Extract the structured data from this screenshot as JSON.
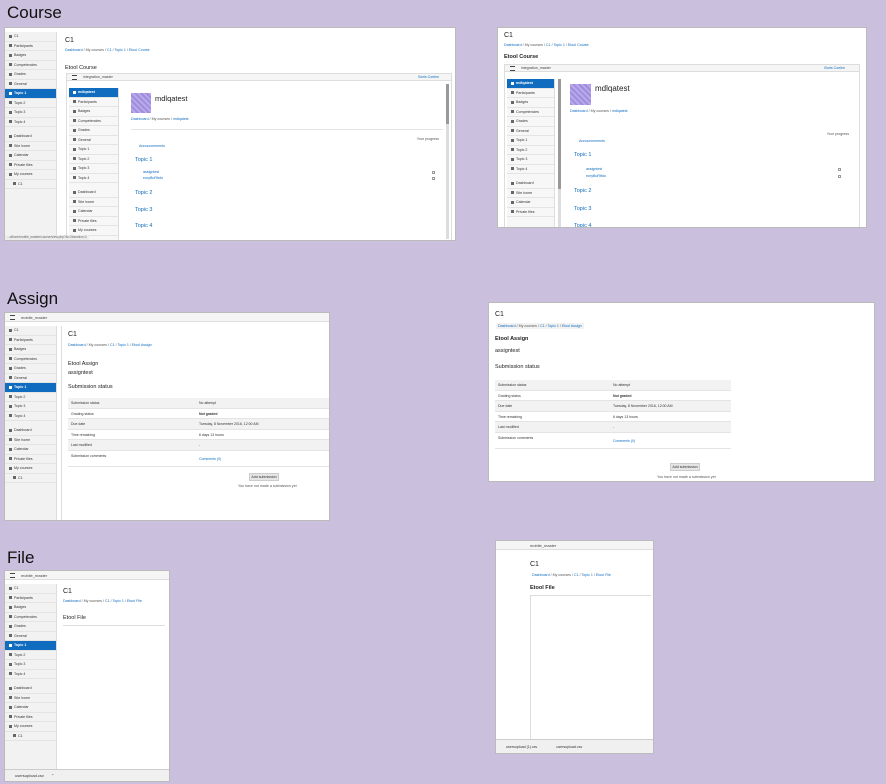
{
  "sections": {
    "course": "Course",
    "assign": "Assign",
    "file": "File"
  },
  "nav": {
    "course_items": [
      "C1",
      "Participants",
      "Badges",
      "Competencies",
      "Grades",
      "General",
      "Topic 1",
      "Topic 2",
      "Topic 3",
      "Topic 4"
    ],
    "site_items": [
      "Dashboard",
      "Site home",
      "Calendar",
      "Private files",
      "My courses",
      "C1"
    ]
  },
  "course_name": "C1",
  "crumbs": {
    "dashboard": "Dashboard",
    "mycourses": "My courses",
    "c1": "C1",
    "topic1": "Topic 1",
    "etool_course": "Etool Course",
    "etool_assign": "Etool Assign",
    "etool_file": "Etool File"
  },
  "course_shot": {
    "heading": "Etool Course",
    "inner_bar_title": "integration_master",
    "inner_bar_right": "Boris Coelen",
    "inner_nav": [
      "mdlqatest",
      "Participants",
      "Badges",
      "Competencies",
      "Grades",
      "General",
      "Topic 1",
      "Topic 2",
      "Topic 3",
      "Topic 4"
    ],
    "inner_site": [
      "Dashboard",
      "Site home",
      "Calendar",
      "Private files",
      "My courses"
    ],
    "user": "mdlqatest",
    "inner_crumbs": [
      "Dashboard",
      "My courses",
      "mdlqatest"
    ],
    "progress": "Your progress",
    "announcements": "Announcements",
    "topics": [
      "Topic 1",
      "Topic 2",
      "Topic 3",
      "Topic 4"
    ],
    "activities": [
      "assigntest",
      "eoryBuRttdo"
    ],
    "status_url": "...uffiure/mobile_master/course/view.php?id=2#section-0"
  },
  "assign_shot": {
    "bar_title": "mobile_master",
    "heading": "Etool Assign",
    "name": "assigntest",
    "submission_status": "Submission status",
    "rows": [
      {
        "k": "Submission status",
        "v": "No attempt"
      },
      {
        "k": "Grading status",
        "v": "Not graded"
      },
      {
        "k": "Due date",
        "v": "Tuesday, 8 November 2016, 12:00 AM"
      },
      {
        "k": "Time remaining",
        "v": "6 days 13 hours"
      },
      {
        "k": "Last modified",
        "v": "-"
      },
      {
        "k": "Submission comments",
        "v": "Comments (0)"
      }
    ],
    "add_button": "Add submission",
    "note": "You have not made a submission yet"
  },
  "file_shot": {
    "bar_title": "mobile_master",
    "heading": "Etool File",
    "download1": "usersupload.csv",
    "download2": "usersupload (1).csv",
    "download3": "usersupload.csv"
  }
}
